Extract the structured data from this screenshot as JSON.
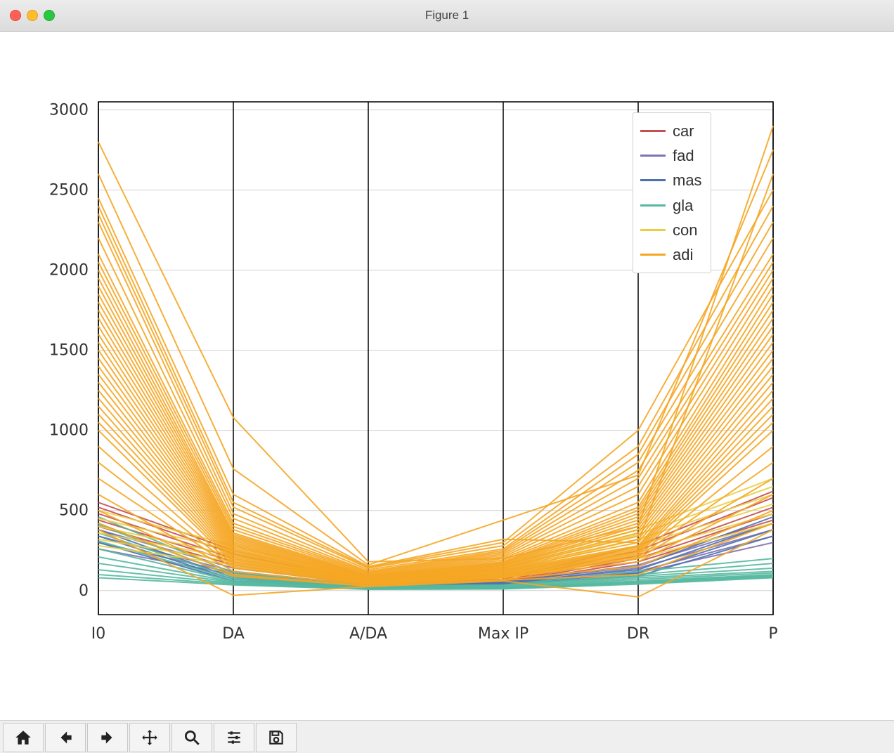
{
  "window": {
    "title": "Figure 1"
  },
  "toolbar": {
    "home": "Home",
    "back": "Back",
    "forward": "Forward",
    "pan": "Pan",
    "zoom": "Zoom",
    "configure": "Configure subplots",
    "save": "Save"
  },
  "chart_data": {
    "type": "parallel-coordinates",
    "title": "",
    "xlabel": "",
    "ylabel": "",
    "ylim": [
      -150,
      3050
    ],
    "yticks": [
      0,
      500,
      1000,
      1500,
      2000,
      2500,
      3000
    ],
    "categories": [
      "I0",
      "DA",
      "A/DA",
      "Max IP",
      "DR",
      "P"
    ],
    "legend": [
      "car",
      "fad",
      "mas",
      "gla",
      "con",
      "adi"
    ],
    "legend_position": "upper-right",
    "colors": {
      "car": "#c44e52",
      "fad": "#8172b3",
      "mas": "#4c72b0",
      "gla": "#55b8a0",
      "con": "#e9d043",
      "adi": "#f5a623"
    },
    "grid": {
      "y": true,
      "x": false
    },
    "series": [
      {
        "class": "car",
        "values": [
          550,
          250,
          60,
          70,
          280,
          620
        ]
      },
      {
        "class": "car",
        "values": [
          520,
          230,
          55,
          60,
          250,
          580
        ]
      },
      {
        "class": "car",
        "values": [
          480,
          200,
          50,
          55,
          220,
          520
        ]
      },
      {
        "class": "car",
        "values": [
          440,
          180,
          45,
          50,
          200,
          480
        ]
      },
      {
        "class": "car",
        "values": [
          400,
          160,
          40,
          45,
          180,
          440
        ]
      },
      {
        "class": "fad",
        "values": [
          380,
          140,
          40,
          50,
          160,
          420
        ]
      },
      {
        "class": "fad",
        "values": [
          340,
          120,
          35,
          45,
          140,
          380
        ]
      },
      {
        "class": "fad",
        "values": [
          300,
          110,
          30,
          40,
          120,
          340
        ]
      },
      {
        "class": "fad",
        "values": [
          260,
          100,
          25,
          35,
          110,
          300
        ]
      },
      {
        "class": "mas",
        "values": [
          420,
          90,
          35,
          55,
          150,
          460
        ]
      },
      {
        "class": "mas",
        "values": [
          380,
          80,
          30,
          50,
          130,
          420
        ]
      },
      {
        "class": "mas",
        "values": [
          340,
          70,
          25,
          45,
          110,
          380
        ]
      },
      {
        "class": "mas",
        "values": [
          300,
          60,
          20,
          40,
          90,
          340
        ]
      },
      {
        "class": "gla",
        "values": [
          460,
          110,
          30,
          35,
          120,
          200
        ]
      },
      {
        "class": "gla",
        "values": [
          410,
          95,
          25,
          30,
          100,
          170
        ]
      },
      {
        "class": "gla",
        "values": [
          360,
          80,
          22,
          26,
          90,
          140
        ]
      },
      {
        "class": "gla",
        "values": [
          310,
          70,
          20,
          22,
          80,
          120
        ]
      },
      {
        "class": "gla",
        "values": [
          260,
          60,
          18,
          20,
          70,
          110
        ]
      },
      {
        "class": "gla",
        "values": [
          210,
          55,
          15,
          18,
          60,
          100
        ]
      },
      {
        "class": "gla",
        "values": [
          170,
          50,
          14,
          16,
          55,
          95
        ]
      },
      {
        "class": "gla",
        "values": [
          130,
          45,
          12,
          14,
          50,
          90
        ]
      },
      {
        "class": "gla",
        "values": [
          100,
          40,
          10,
          12,
          45,
          85
        ]
      },
      {
        "class": "gla",
        "values": [
          80,
          35,
          8,
          10,
          40,
          80
        ]
      },
      {
        "class": "con",
        "values": [
          500,
          280,
          70,
          160,
          380,
          700
        ]
      },
      {
        "class": "con",
        "values": [
          450,
          250,
          60,
          140,
          350,
          650
        ]
      },
      {
        "class": "con",
        "values": [
          400,
          220,
          55,
          120,
          320,
          600
        ]
      },
      {
        "class": "con",
        "values": [
          360,
          200,
          50,
          100,
          280,
          540
        ]
      },
      {
        "class": "con",
        "values": [
          320,
          180,
          45,
          90,
          240,
          480
        ]
      },
      {
        "class": "con",
        "values": [
          280,
          160,
          40,
          80,
          200,
          420
        ]
      },
      {
        "class": "adi",
        "values": [
          2800,
          1080,
          180,
          200,
          400,
          2900
        ]
      },
      {
        "class": "adi",
        "values": [
          2600,
          760,
          160,
          440,
          720,
          2750
        ]
      },
      {
        "class": "adi",
        "values": [
          2450,
          600,
          150,
          320,
          300,
          2600
        ]
      },
      {
        "class": "adi",
        "values": [
          2400,
          550,
          145,
          300,
          1000,
          2500
        ]
      },
      {
        "class": "adi",
        "values": [
          2350,
          520,
          140,
          280,
          900,
          2400
        ]
      },
      {
        "class": "adi",
        "values": [
          2300,
          480,
          130,
          260,
          850,
          2300
        ]
      },
      {
        "class": "adi",
        "values": [
          2200,
          450,
          120,
          250,
          800,
          2200
        ]
      },
      {
        "class": "adi",
        "values": [
          2100,
          420,
          115,
          240,
          750,
          2100
        ]
      },
      {
        "class": "adi",
        "values": [
          2050,
          400,
          110,
          230,
          700,
          2050
        ]
      },
      {
        "class": "adi",
        "values": [
          2000,
          380,
          105,
          220,
          650,
          2000
        ]
      },
      {
        "class": "adi",
        "values": [
          1950,
          360,
          100,
          210,
          600,
          1950
        ]
      },
      {
        "class": "adi",
        "values": [
          1900,
          350,
          95,
          200,
          550,
          1900
        ]
      },
      {
        "class": "adi",
        "values": [
          1850,
          340,
          92,
          190,
          520,
          1850
        ]
      },
      {
        "class": "adi",
        "values": [
          1800,
          330,
          90,
          180,
          500,
          1800
        ]
      },
      {
        "class": "adi",
        "values": [
          1750,
          320,
          88,
          175,
          480,
          1750
        ]
      },
      {
        "class": "adi",
        "values": [
          1700,
          310,
          85,
          170,
          460,
          1700
        ]
      },
      {
        "class": "adi",
        "values": [
          1650,
          300,
          82,
          165,
          440,
          1650
        ]
      },
      {
        "class": "adi",
        "values": [
          1600,
          290,
          80,
          160,
          420,
          1600
        ]
      },
      {
        "class": "adi",
        "values": [
          1550,
          280,
          78,
          155,
          400,
          1550
        ]
      },
      {
        "class": "adi",
        "values": [
          1500,
          270,
          75,
          150,
          380,
          1500
        ]
      },
      {
        "class": "adi",
        "values": [
          1450,
          260,
          70,
          145,
          360,
          1450
        ]
      },
      {
        "class": "adi",
        "values": [
          1400,
          250,
          68,
          140,
          340,
          1400
        ]
      },
      {
        "class": "adi",
        "values": [
          1350,
          240,
          65,
          135,
          320,
          1350
        ]
      },
      {
        "class": "adi",
        "values": [
          1300,
          230,
          62,
          130,
          300,
          1300
        ]
      },
      {
        "class": "adi",
        "values": [
          1250,
          220,
          60,
          125,
          280,
          1250
        ]
      },
      {
        "class": "adi",
        "values": [
          1200,
          210,
          58,
          120,
          270,
          1200
        ]
      },
      {
        "class": "adi",
        "values": [
          1150,
          200,
          55,
          115,
          260,
          1150
        ]
      },
      {
        "class": "adi",
        "values": [
          1100,
          190,
          52,
          110,
          250,
          1100
        ]
      },
      {
        "class": "adi",
        "values": [
          1050,
          180,
          50,
          105,
          240,
          1050
        ]
      },
      {
        "class": "adi",
        "values": [
          1000,
          170,
          48,
          100,
          230,
          1000
        ]
      },
      {
        "class": "adi",
        "values": [
          900,
          160,
          45,
          95,
          220,
          900
        ]
      },
      {
        "class": "adi",
        "values": [
          800,
          150,
          42,
          90,
          210,
          800
        ]
      },
      {
        "class": "adi",
        "values": [
          700,
          140,
          40,
          85,
          200,
          700
        ]
      },
      {
        "class": "adi",
        "values": [
          600,
          120,
          35,
          80,
          180,
          600
        ]
      },
      {
        "class": "adi",
        "values": [
          500,
          100,
          30,
          70,
          150,
          500
        ]
      },
      {
        "class": "adi",
        "values": [
          420,
          90,
          28,
          65,
          100,
          420
        ]
      },
      {
        "class": "adi",
        "values": [
          380,
          -30,
          25,
          60,
          -40,
          380
        ]
      }
    ]
  }
}
